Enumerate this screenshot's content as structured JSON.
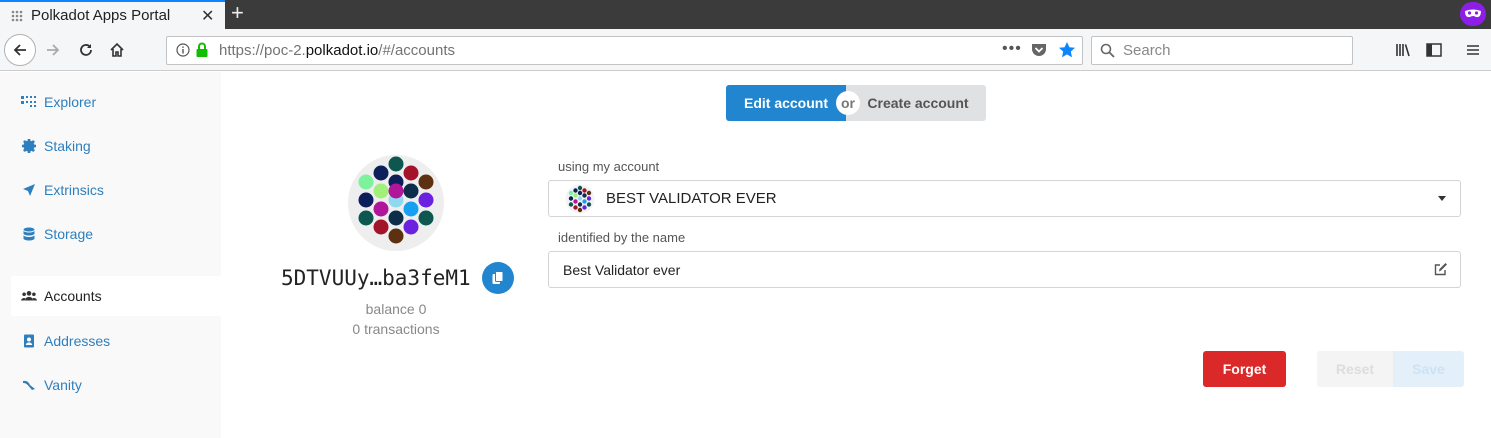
{
  "browser": {
    "tab_title": "Polkadot Apps Portal",
    "url_prefix": "https://poc-2.",
    "url_domain": "polkadot.io",
    "url_path": "/#/accounts",
    "search_placeholder": "Search"
  },
  "sidebar": {
    "items": [
      {
        "label": "Explorer",
        "icon": "grid-icon"
      },
      {
        "label": "Staking",
        "icon": "certificate-icon"
      },
      {
        "label": "Extrinsics",
        "icon": "send-icon"
      },
      {
        "label": "Storage",
        "icon": "database-icon"
      },
      {
        "label": "Accounts",
        "icon": "users-icon",
        "active": true
      },
      {
        "label": "Addresses",
        "icon": "address-book-icon"
      },
      {
        "label": "Vanity",
        "icon": "trophy-icon"
      }
    ]
  },
  "main": {
    "toggle": {
      "edit": "Edit account",
      "or": "or",
      "create": "Create account"
    },
    "account": {
      "address": "5DTVUUy…ba3feM1",
      "balance": "balance 0",
      "transactions": "0 transactions"
    },
    "form": {
      "account_label": "using my account",
      "selected_account": "BEST VALIDATOR EVER",
      "name_label": "identified by the name",
      "name_value": "Best Validator ever"
    },
    "buttons": {
      "forget": "Forget",
      "reset": "Reset",
      "save": "Save"
    }
  },
  "colors": {
    "primary": "#2185d0",
    "danger": "#db2828",
    "link": "#2e7fbd"
  }
}
